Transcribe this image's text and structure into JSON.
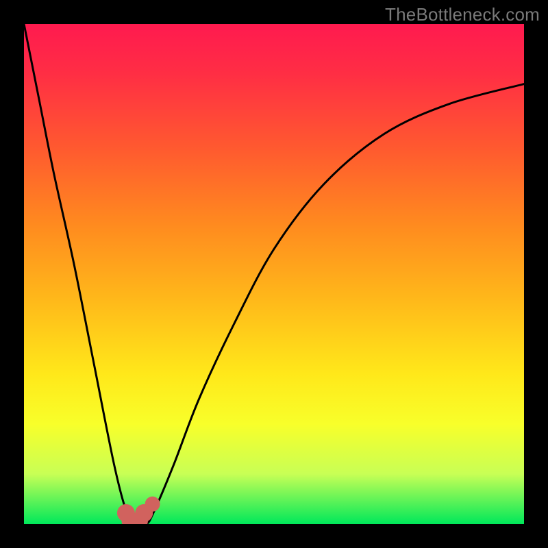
{
  "watermark": "TheBottleneck.com",
  "chart_data": {
    "type": "line",
    "title": "",
    "xlabel": "",
    "ylabel": "",
    "ylim": [
      0,
      1
    ],
    "xlim": [
      0,
      1
    ],
    "series": [
      {
        "name": "bottleneck-curve",
        "x": [
          0.0,
          0.03,
          0.06,
          0.1,
          0.14,
          0.18,
          0.205,
          0.225,
          0.245,
          0.26,
          0.3,
          0.35,
          0.42,
          0.5,
          0.6,
          0.72,
          0.85,
          1.0
        ],
        "y": [
          1.0,
          0.85,
          0.7,
          0.52,
          0.32,
          0.12,
          0.025,
          0.0,
          0.0,
          0.025,
          0.12,
          0.25,
          0.4,
          0.55,
          0.68,
          0.78,
          0.84,
          0.88
        ]
      }
    ],
    "markers": [
      {
        "name": "upper-dot",
        "x": 0.257,
        "y": 0.04,
        "r": 11
      },
      {
        "name": "u-left",
        "x": 0.204,
        "y": 0.022,
        "r": 13
      },
      {
        "name": "u-bottom-l",
        "x": 0.213,
        "y": 0.006,
        "r": 13
      },
      {
        "name": "u-bottom-r",
        "x": 0.23,
        "y": 0.006,
        "r": 13
      },
      {
        "name": "u-right",
        "x": 0.24,
        "y": 0.022,
        "r": 13
      }
    ],
    "marker_color": "#d1625e",
    "curve_color": "#000000"
  }
}
